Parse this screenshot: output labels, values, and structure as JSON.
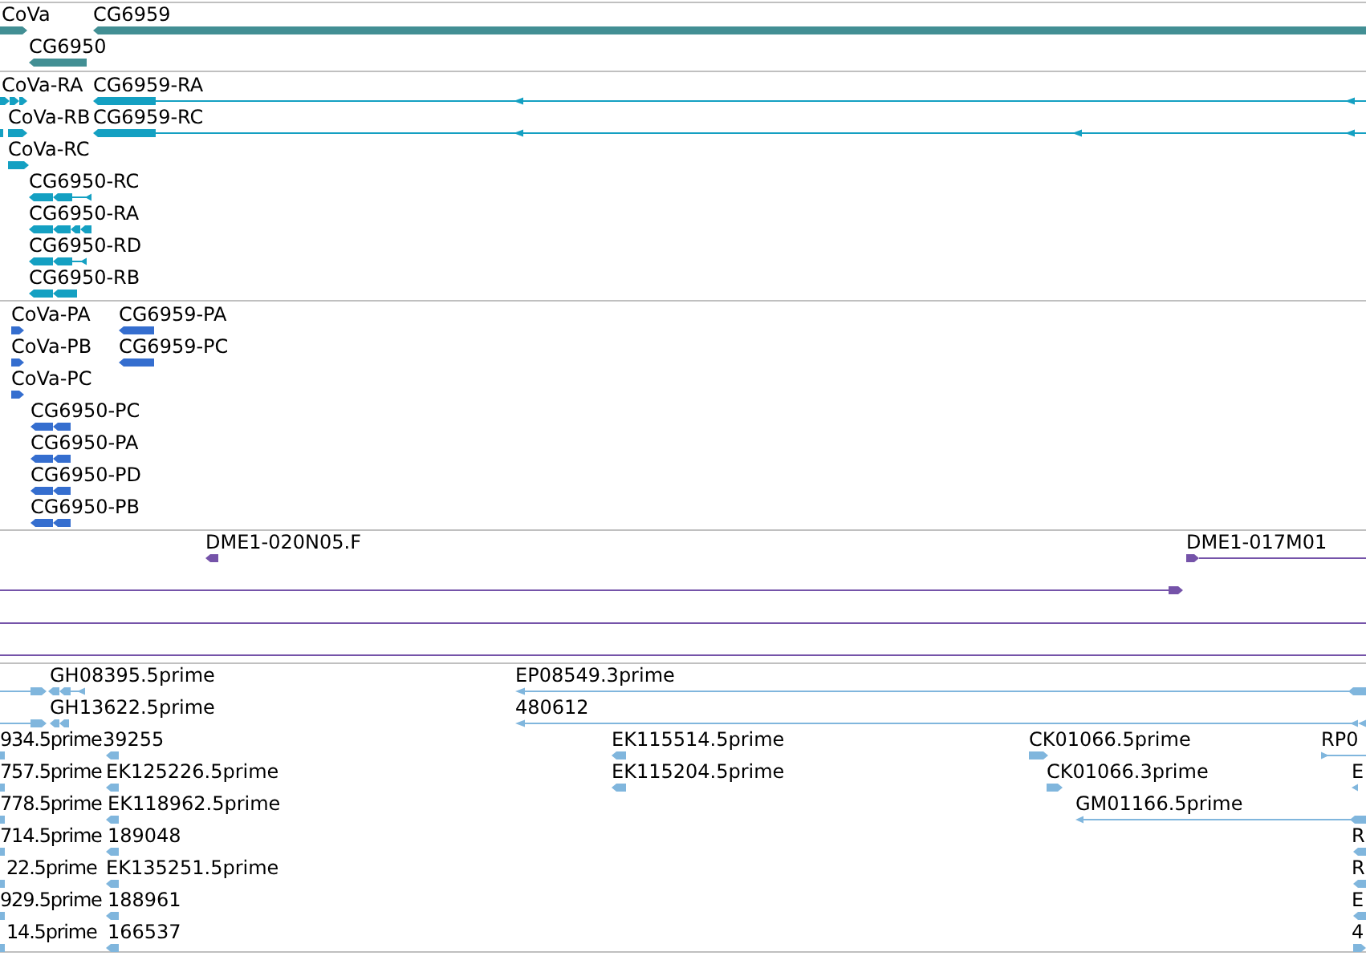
{
  "tracks": [
    {
      "color": "#428f94",
      "features": [
        {
          "label": "CoVa"
        },
        {
          "label": "CG6959"
        },
        {
          "label": "CG6950"
        }
      ]
    },
    {
      "color": "#14a0c2",
      "features": [
        {
          "label": "CoVa-RA"
        },
        {
          "label": "CG6959-RA"
        },
        {
          "label": "CoVa-RB"
        },
        {
          "label": "CG6959-RC"
        },
        {
          "label": "CoVa-RC"
        },
        {
          "label": "CG6950-RC"
        },
        {
          "label": "CG6950-RA"
        },
        {
          "label": "CG6950-RD"
        },
        {
          "label": "CG6950-RB"
        }
      ]
    },
    {
      "color": "#356ecf",
      "features": [
        {
          "label": "CoVa-PA"
        },
        {
          "label": "CG6959-PA"
        },
        {
          "label": "CoVa-PB"
        },
        {
          "label": "CG6959-PC"
        },
        {
          "label": "CoVa-PC"
        },
        {
          "label": "CG6950-PC"
        },
        {
          "label": "CG6950-PA"
        },
        {
          "label": "CG6950-PD"
        },
        {
          "label": "CG6950-PB"
        }
      ]
    },
    {
      "color": "#7553a9",
      "features": [
        {
          "label": "DME1-020N05.F"
        },
        {
          "label": "DME1-017M01"
        }
      ]
    },
    {
      "color": "#80b6dd",
      "features": [
        {
          "label": "GH08395.5prime"
        },
        {
          "label": "EP08549.3prime"
        },
        {
          "label": "GH13622.5prime"
        },
        {
          "label": "480612"
        },
        {
          "label": "934.5prime"
        },
        {
          "label": "39255"
        },
        {
          "label": "EK115514.5prime"
        },
        {
          "label": "CK01066.5prime"
        },
        {
          "label": "RP0"
        },
        {
          "label": "757.5prime"
        },
        {
          "label": "EK125226.5prime"
        },
        {
          "label": "EK115204.5prime"
        },
        {
          "label": "CK01066.3prime"
        },
        {
          "label": "E"
        },
        {
          "label": "778.5prime"
        },
        {
          "label": "EK118962.5prime"
        },
        {
          "label": "GM01166.5prime"
        },
        {
          "label": "714.5prime"
        },
        {
          "label": "189048"
        },
        {
          "label": "R"
        },
        {
          "label": "22.5prime"
        },
        {
          "label": "EK135251.5prime"
        },
        {
          "label": "R"
        },
        {
          "label": "929.5prime"
        },
        {
          "label": "188961"
        },
        {
          "label": "E"
        },
        {
          "label": "14.5prime"
        },
        {
          "label": "166537"
        },
        {
          "label": "4"
        }
      ]
    }
  ]
}
